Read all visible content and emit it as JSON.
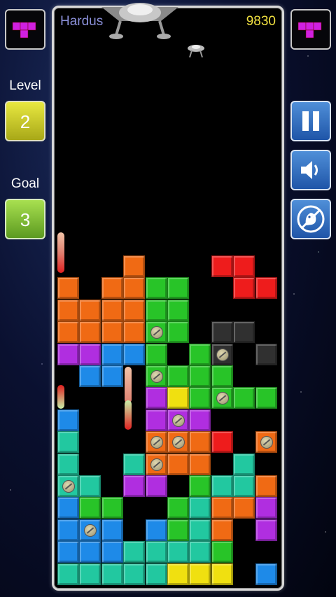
{
  "player_name": "Hardus",
  "score": "9830",
  "level_label": "Level",
  "level_value": "2",
  "goal_label": "Goal",
  "goal_value": "3",
  "icons": {
    "next_piece": "t-tetromino-icon",
    "hold_piece": "t-tetromino-icon",
    "pause": "pause-icon",
    "sound": "speaker-icon",
    "ghost": "ghost-icon"
  },
  "colors": {
    "orange": "#f06a14",
    "green": "#28c428",
    "red": "#ee1c1c",
    "purple": "#b02ee0",
    "blue": "#1e8ae8",
    "yellow": "#f0e010",
    "teal": "#22c8a0",
    "gray": "#303030",
    "magenta": "#d020e0"
  }
}
